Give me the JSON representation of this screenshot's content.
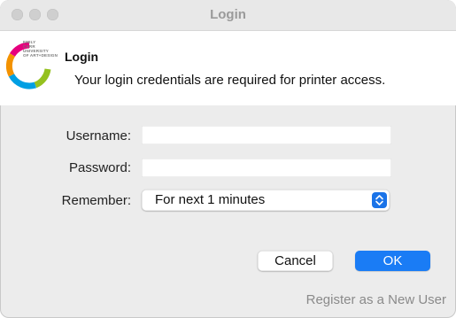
{
  "window": {
    "title": "Login"
  },
  "logo": {
    "name": "emily-carr-logo",
    "lines": [
      "EMILY",
      "CARR",
      "UNIVERSITY",
      "OF ART+DESIGN"
    ],
    "colors": [
      "#e6007e",
      "#f39200",
      "#95c11f",
      "#009fe3"
    ]
  },
  "header": {
    "title": "Login",
    "message": "Your login credentials are required for printer access."
  },
  "form": {
    "username_label": "Username:",
    "username_value": "",
    "password_label": "Password:",
    "password_value": "",
    "remember_label": "Remember:",
    "remember_value": "For next 1 minutes"
  },
  "buttons": {
    "cancel": "Cancel",
    "ok": "OK"
  },
  "links": {
    "register": "Register as a New User"
  },
  "colors": {
    "accent": "#1a7cf5",
    "window_bg": "#ececec",
    "link_text": "#8a8a8a"
  }
}
